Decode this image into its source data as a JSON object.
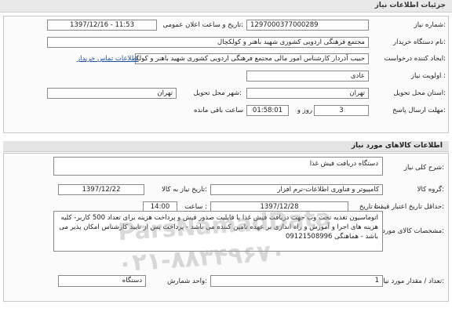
{
  "header": {
    "title": "جزئیات اطلاعات نیاز"
  },
  "info": {
    "need_number_label": "شماره نیاز:",
    "need_number": "1297000377000289",
    "announce_label": "تاریخ و ساعت اعلان عمومی:",
    "announce_value": "1397/12/16 - 11:53",
    "buyer_label": "نام دستگاه خریدار:",
    "buyer_value": "مجتمع فرهنگی اردویی کشوری شهید باهنر و کولکچال",
    "creator_label": "ایجاد کننده درخواست:",
    "creator_value": "حبیب آذردار کارشناس امور مالی  مجتمع فرهنگی اردویی کشوری شهید باهنر و کولکچال",
    "contact_link": "اطلاعات تماس خریدار",
    "priority_label": "اولویت نیاز :",
    "priority_value": "عادی",
    "province_label": "استان محل تحویل:",
    "province_value": "تهران",
    "city_label": "شهر محل تحویل:",
    "city_value": "تهران",
    "deadline_label": "مهلت ارسال پاسخ:",
    "deadline_days": "3",
    "days_unit": "روز و",
    "deadline_time": "01:58:01",
    "remaining_label": "ساعت باقی مانده"
  },
  "goods": {
    "section_title": "اطلاعات کالاهای مورد نیاز",
    "summary_label": "شرح کلی نیاز:",
    "summary_value": "دستگاه دریافت فیش غذا",
    "group_label": "گروه کالا:",
    "group_value": "کامپیوتر و فناوری اطلاعات-نرم افزار",
    "need_date_label": "تاریخ نیاز به کالا:",
    "need_date_value": "1397/12/22",
    "validity_label": "حداقل تاریخ اعتبار قیمت:",
    "validity_to": "تا تاریخ :",
    "validity_date": "1397/12/28",
    "time_label": "ساعت :",
    "time_value": "14:00",
    "specs_label": "مشخصات کالای مورد نیاز:",
    "specs_text": "اتوماسیون تغذیه تحت وب جهت دریافت فیش غذا با قابلیت صدور فیش و پرداخت هزینه برای تعداد 500 کاربر- کلیه هزینه های اجرا و آموزش و راه اندازی بر عهده تامین کننده می باشد - پرداخت پس از تایید کارشناس امکان پذیر می باشد - هماهنگی 09121508996",
    "qty_label": "تعداد / مقدار مورد نیاز:",
    "qty_value": "1",
    "unit_label": "واحد شمارش:",
    "unit_value": "دستگاه"
  },
  "watermark": {
    "line1": "ParsNamadData",
    "line2": "۰۲۱-۸۸۳۴۹۶۷۰"
  }
}
